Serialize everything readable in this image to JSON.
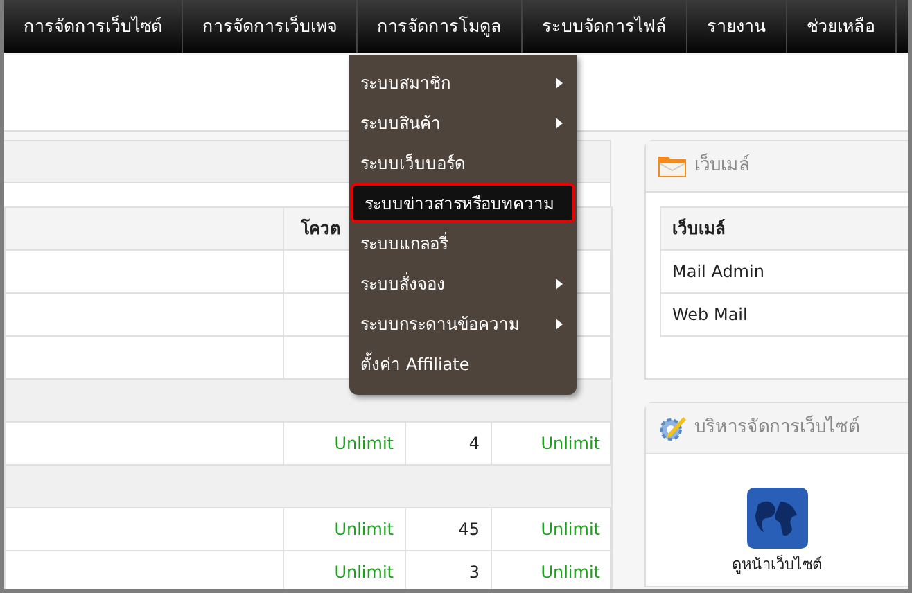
{
  "navbar": {
    "items": [
      {
        "label": "การจัดการเว็บไซต์"
      },
      {
        "label": "การจัดการเว็บเพจ"
      },
      {
        "label": "การจัดการโมดูล"
      },
      {
        "label": "ระบบจัดการไฟล์"
      },
      {
        "label": "รายงาน"
      },
      {
        "label": "ช่วยเหลือ"
      }
    ]
  },
  "dropdown_menu": {
    "items": [
      {
        "label": "ระบบสมาชิก",
        "has_submenu": true,
        "selected": false
      },
      {
        "label": "ระบบสินค้า",
        "has_submenu": true,
        "selected": false
      },
      {
        "label": "ระบบเว็บบอร์ด",
        "has_submenu": false,
        "selected": false
      },
      {
        "label": "ระบบข่าวสารหรือบทความ",
        "has_submenu": false,
        "selected": true
      },
      {
        "label": "ระบบแกลอรี่",
        "has_submenu": false,
        "selected": false
      },
      {
        "label": "ระบบสั่งจอง",
        "has_submenu": true,
        "selected": false
      },
      {
        "label": "ระบบกระดานข้อความ",
        "has_submenu": true,
        "selected": false
      },
      {
        "label": "ตั้งค่า Affiliate",
        "has_submenu": false,
        "selected": false
      }
    ]
  },
  "quota_table": {
    "columns": [
      "โควต"
    ],
    "rows": [
      {
        "kind": "covered"
      },
      {
        "kind": "covered"
      },
      {
        "kind": "covered"
      },
      {
        "kind": "group",
        "cells": []
      },
      {
        "kind": "data",
        "cells": [
          "",
          "Unlimit",
          "4",
          "Unlimit"
        ]
      },
      {
        "kind": "group",
        "cells": []
      },
      {
        "kind": "data",
        "cells": [
          "",
          "Unlimit",
          "45",
          "Unlimit"
        ]
      },
      {
        "kind": "data",
        "cells": [
          "",
          "Unlimit",
          "3",
          "Unlimit"
        ]
      }
    ]
  },
  "webmail_card": {
    "title": "เว็บเมล์",
    "column": "เว็บเมล์",
    "rows": [
      "Mail Admin",
      "Web Mail"
    ]
  },
  "site_admin_card": {
    "title": "บริหารจัดการเว็บไซต์",
    "shortcuts": [
      {
        "label": "ดูหน้าเว็บไซต์"
      }
    ]
  }
}
